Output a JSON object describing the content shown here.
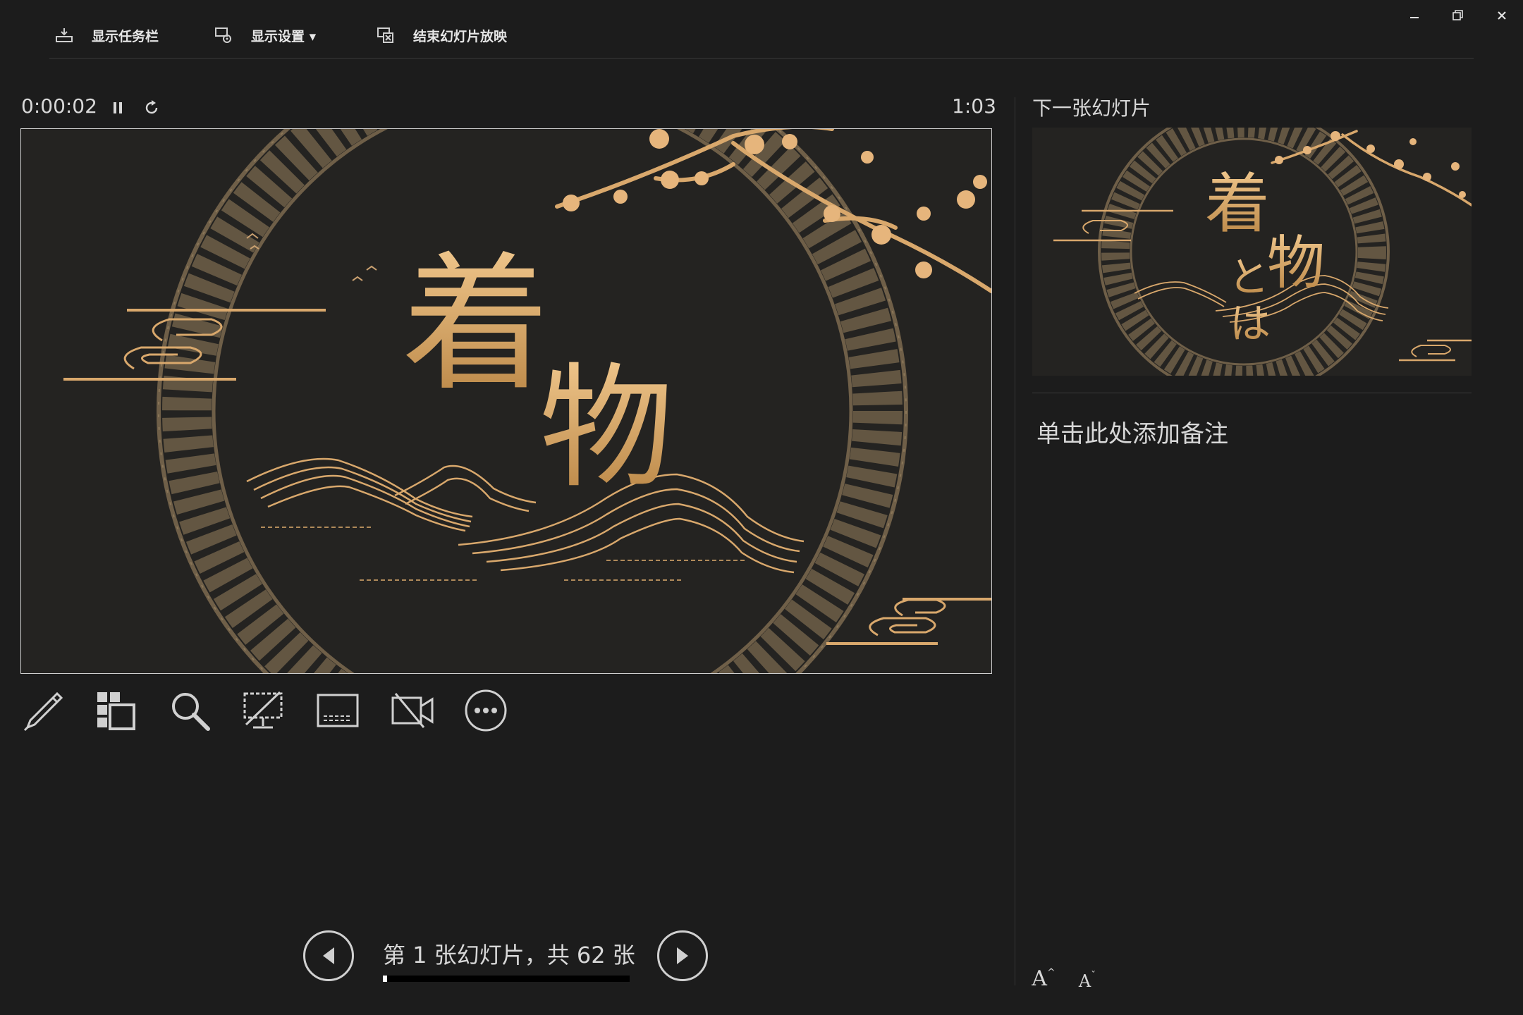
{
  "toolbar": {
    "show_taskbar": "显示任务栏",
    "display_settings": "显示设置 ▾",
    "end_show": "结束幻灯片放映"
  },
  "window_controls": {
    "minimize": "–",
    "restore": "🗗",
    "close": "✕"
  },
  "presenter": {
    "elapsed_time": "0:00:02",
    "current_time": "1:03",
    "pause_icon": "pause-icon",
    "reset_icon": "reset-timer-icon"
  },
  "current_slide": {
    "title_char_1": "着",
    "title_char_2": "物"
  },
  "next_slide": {
    "label": "下一张幻灯片",
    "title_char_1": "着",
    "title_char_2": "物",
    "title_char_3": "と",
    "title_char_4": "は"
  },
  "tools": [
    "pen-tool-icon",
    "see-all-slides-icon",
    "zoom-icon",
    "black-screen-icon",
    "subtitles-icon",
    "camera-off-icon",
    "more-options-icon"
  ],
  "navigation": {
    "counter": "第 1 张幻灯片，共 62 张",
    "current": 1,
    "total": 62,
    "progress_fraction": 0.016
  },
  "notes": {
    "placeholder": "单击此处添加备注"
  },
  "font_controls": {
    "increase": "A",
    "decrease": "A"
  },
  "colors": {
    "background": "#1c1c1c",
    "gold": "#d9a86c",
    "ornament": "#7a6a52",
    "slide_bg": "#242321"
  }
}
